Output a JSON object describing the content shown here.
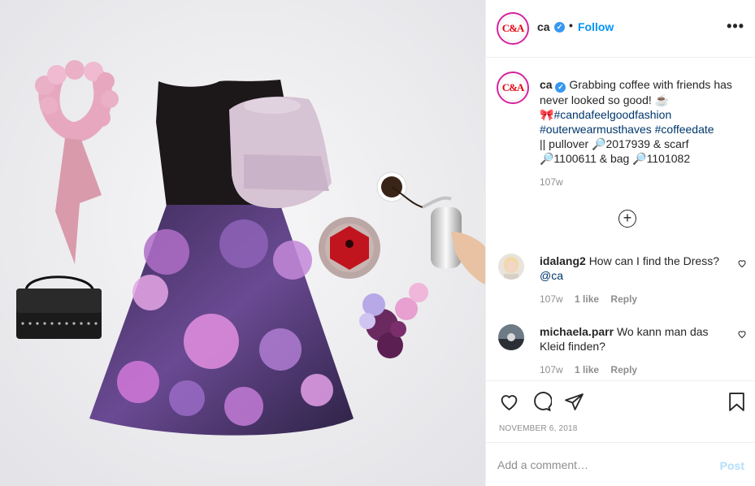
{
  "post": {
    "image_alt": "Flat lay of a floral dress, pink pullover, pink fur scarf, black bag, coffee and flowers"
  },
  "header": {
    "logo_text": "C&A",
    "username": "ca",
    "separator": "•",
    "follow_label": "Follow",
    "more_label": "•••"
  },
  "caption": {
    "logo_text": "C&A",
    "username": "ca",
    "text_main": "Grabbing coffee with friends has never looked so good! ☕",
    "emoji_bow": "🎀",
    "hashtag1": "#candafeelgoodfashion",
    "hashtag2": "#outerwearmusthaves",
    "hashtag3": "#coffeedate",
    "details_line1": "|| pullover 🔎2017939 & scarf",
    "details_line2": "🔎1100611 & bag 🔎1101082",
    "time": "107w"
  },
  "load_more_label": "+",
  "comments": [
    {
      "username": "idalang2",
      "text": "How can I find the Dress?",
      "mention": "@ca",
      "time": "107w",
      "likes": "1 like",
      "reply": "Reply"
    },
    {
      "username": "michaela.parr",
      "text": "Wo kann man das Kleid finden?",
      "time": "107w",
      "likes": "1 like",
      "reply": "Reply"
    }
  ],
  "icons": {
    "like": "heart-icon",
    "comment": "comment-icon",
    "share": "share-icon",
    "save": "bookmark-icon",
    "verified": "verified-badge-icon"
  },
  "date": "November 6, 2018",
  "add_comment": {
    "placeholder": "Add a comment…",
    "post_label": "Post"
  },
  "colors": {
    "link_blue": "#0095f6",
    "hashtag_blue": "#00376b",
    "post_disabled": "#b2dffc",
    "brand_red": "#e30613",
    "muted": "#8e8e8e"
  }
}
